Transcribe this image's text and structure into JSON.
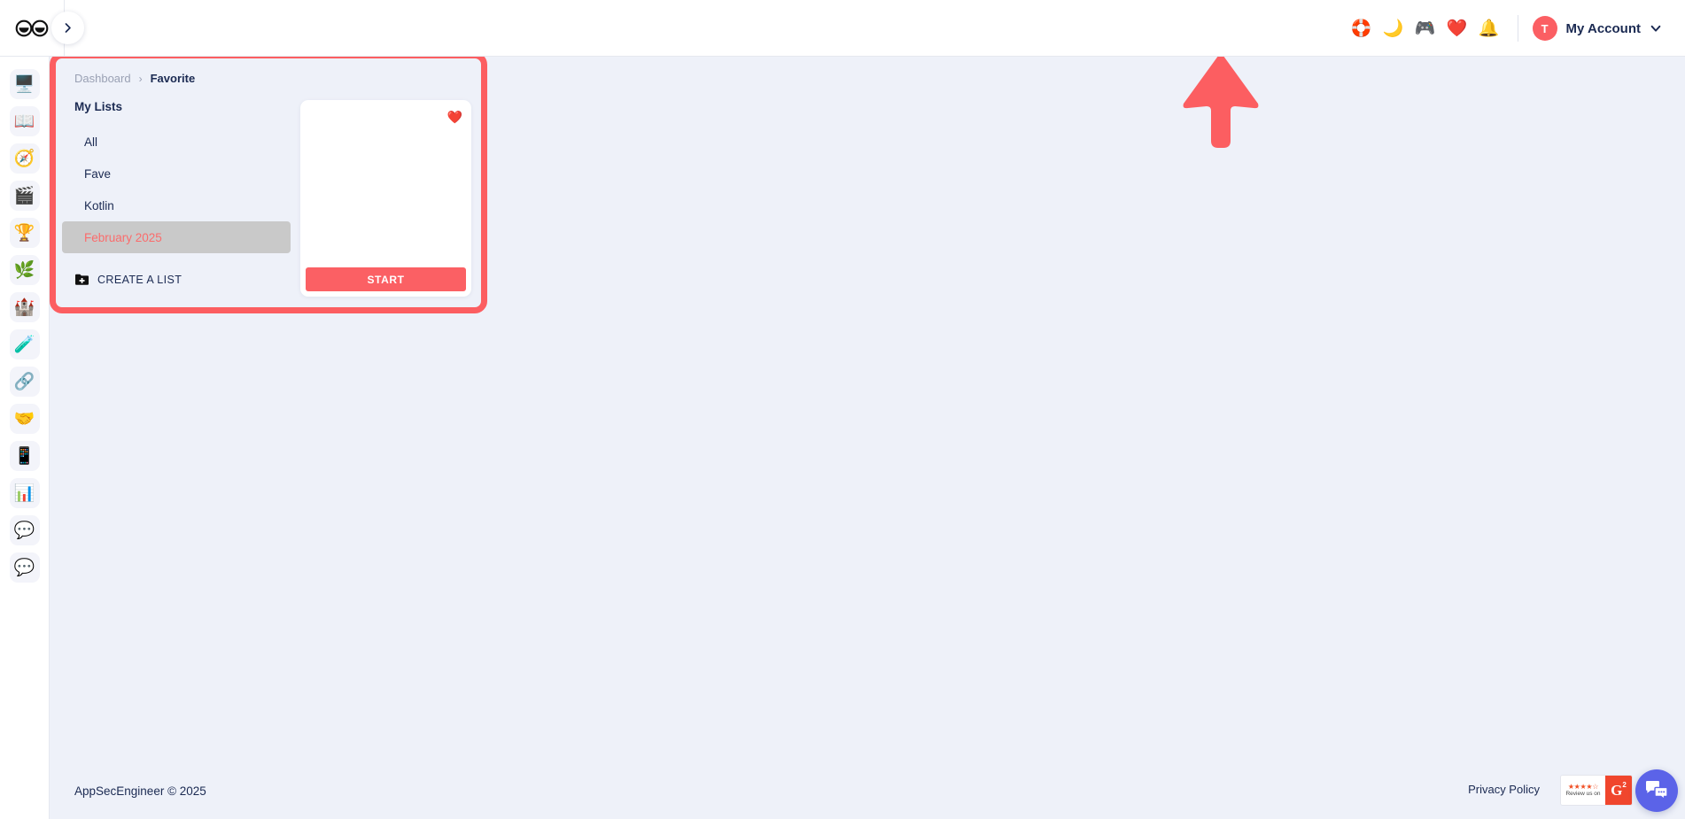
{
  "topbar": {
    "logo_icon": "infinity-eyes-logo",
    "collapse_icon": "chevron-right-icon",
    "icons": [
      {
        "name": "lifebuoy-help-icon",
        "glyph": "🛟"
      },
      {
        "name": "dark-mode-moon-icon",
        "glyph": "🌙"
      },
      {
        "name": "discord-icon",
        "glyph": "🎮"
      },
      {
        "name": "favorites-heart-icon",
        "glyph": "❤️"
      },
      {
        "name": "notifications-bell-icon",
        "glyph": "🔔"
      }
    ],
    "account": {
      "avatar_initial": "T",
      "label": "My Account",
      "caret_icon": "chevron-down-icon"
    }
  },
  "sidebar": {
    "items": [
      {
        "name": "dashboard",
        "glyph": "🖥️"
      },
      {
        "name": "learning-paths",
        "glyph": "📖"
      },
      {
        "name": "explore",
        "glyph": "🧭"
      },
      {
        "name": "videos",
        "glyph": "🎬"
      },
      {
        "name": "achievements",
        "glyph": "🏆"
      },
      {
        "name": "skills",
        "glyph": "🌿"
      },
      {
        "name": "challenges",
        "glyph": "🏰"
      },
      {
        "name": "labs",
        "glyph": "🧪"
      },
      {
        "name": "community",
        "glyph": "🔗"
      },
      {
        "name": "teams",
        "glyph": "🤝"
      },
      {
        "name": "courses",
        "glyph": "📱"
      },
      {
        "name": "reports",
        "glyph": "📊"
      },
      {
        "name": "support-chat",
        "glyph": "💬"
      },
      {
        "name": "feedback-chat",
        "glyph": "💬"
      }
    ]
  },
  "panel": {
    "breadcrumb": {
      "parent": "Dashboard",
      "separator": "›",
      "current": "Favorite"
    },
    "my_lists_label": "My Lists",
    "lists": [
      {
        "label": "All",
        "selected": false
      },
      {
        "label": "Fave",
        "selected": false
      },
      {
        "label": "Kotlin",
        "selected": false
      },
      {
        "label": "February 2025",
        "selected": true
      }
    ],
    "create_list": {
      "icon": "folder-plus-icon",
      "label": "CREATE A LIST"
    },
    "card": {
      "heart_icon": "❤️",
      "start_label": "START"
    }
  },
  "annotation": {
    "arrow_name": "red-up-arrow-annotation",
    "highlight_name": "red-highlight-rectangle",
    "color": "#fc5e61"
  },
  "footer": {
    "copyright": "AppSecEngineer © 2025",
    "privacy_label": "Privacy Policy",
    "g2": {
      "stars": "★★★★☆",
      "review_text": "Review us on",
      "logo": "G",
      "superscript": "2"
    },
    "chat_icon": "chat-bubble-icon"
  },
  "colors": {
    "accent": "#fb6064",
    "page_bg": "#eef1f9",
    "text": "#1b2a52",
    "muted": "#9aa1b4",
    "selected_row": "#c9c9c9"
  }
}
